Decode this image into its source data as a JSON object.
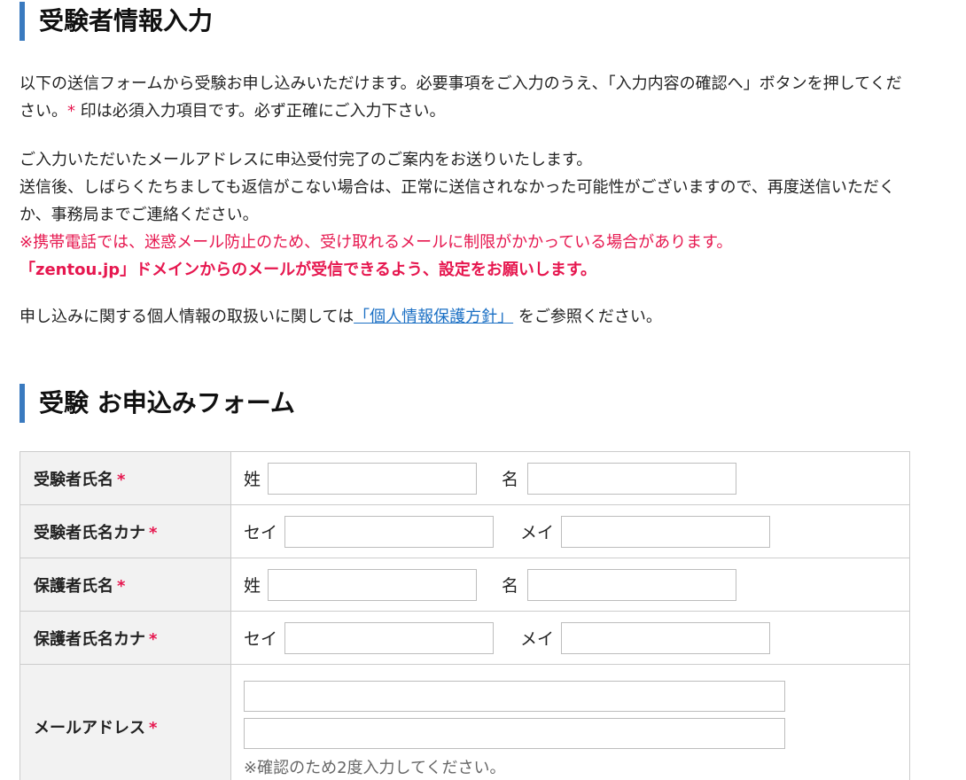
{
  "section1": {
    "heading": "受験者情報入力",
    "intro": {
      "line1_pre": "以下の送信フォームから受験お申し込みいただけます。必要事項をご入力のうえ、「入力内容の確認へ」ボタンを押してください。",
      "asterisk": "*",
      "line1_post": " 印は必須入力項目です。必ず正確にご入力下さい。"
    },
    "notice": {
      "line1": "ご入力いただいたメールアドレスに申込受付完了のご案内をお送りいたします。",
      "line2": "送信後、しばらくたちましても返信がこない場合は、正常に送信されなかった可能性がございますので、再度送信いただくか、事務局までご連絡ください。",
      "warning": "※携帯電話では、迷惑メール防止のため、受け取れるメールに制限がかかっている場合があります。",
      "warning_bold": "「zentou.jp」ドメインからのメールが受信できるよう、設定をお願いします。"
    },
    "privacy": {
      "pre": "申し込みに関する個人情報の取扱いに関しては",
      "link": "「個人情報保護方針」",
      "post": " をご参照ください。"
    }
  },
  "section2": {
    "heading": "受験 お申込みフォーム"
  },
  "form": {
    "required_mark": "*",
    "rows": [
      {
        "label": "受験者氏名",
        "first_label": "姓",
        "second_label": "名",
        "first_value": "",
        "second_value": ""
      },
      {
        "label": "受験者氏名カナ",
        "first_label": "セイ",
        "second_label": "メイ",
        "first_value": "",
        "second_value": ""
      },
      {
        "label": "保護者氏名",
        "first_label": "姓",
        "second_label": "名",
        "first_value": "",
        "second_value": ""
      },
      {
        "label": "保護者氏名カナ",
        "first_label": "セイ",
        "second_label": "メイ",
        "first_value": "",
        "second_value": ""
      }
    ],
    "email": {
      "label": "メールアドレス",
      "value": "",
      "confirm_value": "",
      "note": "※確認のため2度入力してください。"
    }
  },
  "colors": {
    "accent_bar": "#3a7abf",
    "required": "#e6174f",
    "link": "#1a6fc4",
    "label_bg": "#f2f2f2"
  }
}
